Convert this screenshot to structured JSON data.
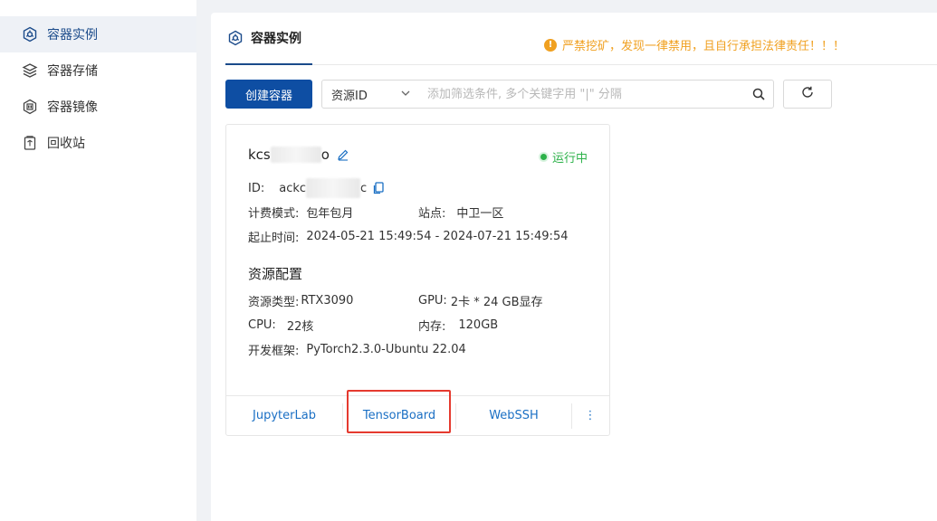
{
  "sidebar": {
    "items": [
      {
        "label": "容器实例",
        "icon": "container-instance-icon",
        "active": true
      },
      {
        "label": "容器存储",
        "icon": "layers-storage-icon",
        "active": false
      },
      {
        "label": "容器镜像",
        "icon": "image-disk-icon",
        "active": false
      },
      {
        "label": "回收站",
        "icon": "trash-icon",
        "active": false
      }
    ]
  },
  "header": {
    "tab_label": "容器实例",
    "warning": "严禁挖矿，发现一律禁用，且自行承担法律责任！！！"
  },
  "toolbar": {
    "create_label": "创建容器",
    "filter_select": "资源ID",
    "search_placeholder": "添加筛选条件, 多个关键字用 \"|\" 分隔"
  },
  "instance": {
    "name_prefix": "kcs",
    "name_suffix": "o",
    "status": "运行中",
    "id_label": "ID:",
    "id_prefix": "ackc",
    "id_suffix": "c",
    "billing_label": "计费模式:",
    "billing_value": "包年包月",
    "site_label": "站点:",
    "site_value": "中卫一区",
    "period_label": "起止时间:",
    "period_value": "2024-05-21 15:49:54 - 2024-07-21 15:49:54",
    "config_title": "资源配置",
    "res_type_label": "资源类型:",
    "res_type_value": "RTX3090",
    "gpu_label": "GPU:",
    "gpu_value": "2卡 * 24 GB显存",
    "cpu_label": "CPU:",
    "cpu_value": "22核",
    "mem_label": "内存:",
    "mem_value": "120GB",
    "framework_label": "开发框架:",
    "framework_value": "PyTorch2.3.0-Ubuntu 22.04",
    "actions": [
      "JupyterLab",
      "TensorBoard",
      "WebSSH"
    ],
    "more_label": "⋮"
  },
  "colors": {
    "primary": "#0e4ea3",
    "link": "#1a6fc4",
    "running": "#2db24a",
    "warning": "#f0a020",
    "highlight": "#e53a2f"
  }
}
